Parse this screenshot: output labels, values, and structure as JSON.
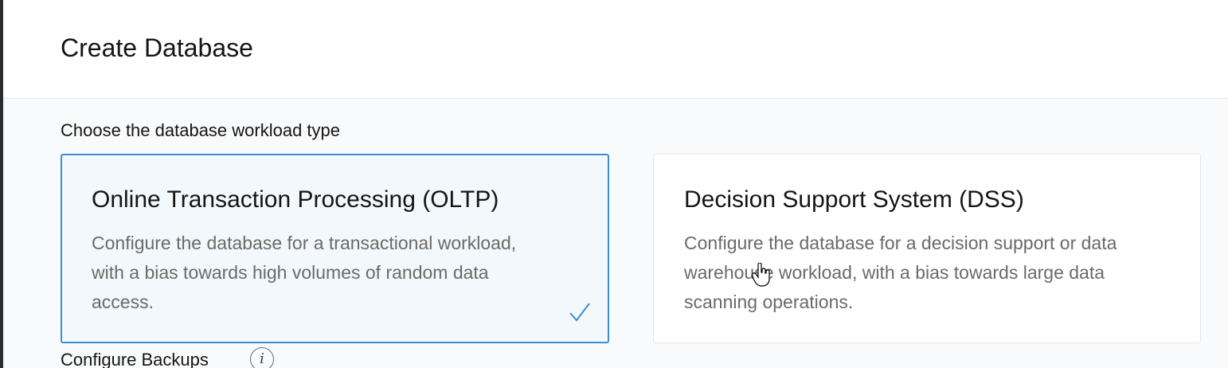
{
  "header": {
    "title": "Create Database"
  },
  "workload": {
    "label": "Choose the database workload type",
    "options": [
      {
        "title": "Online Transaction Processing (OLTP)",
        "description": "Configure the database for a transactional workload, with a bias towards high volumes of random data access.",
        "selected": true
      },
      {
        "title": "Decision Support System (DSS)",
        "description": "Configure the database for a decision support or data warehouse workload, with a bias towards large data scanning operations.",
        "selected": false
      }
    ]
  },
  "backups": {
    "label": "Configure Backups",
    "info_glyph": "i"
  },
  "colors": {
    "selected_border": "#3a8fd4",
    "selected_background": "#f2f8fc",
    "check_color": "#3a8fd4"
  }
}
